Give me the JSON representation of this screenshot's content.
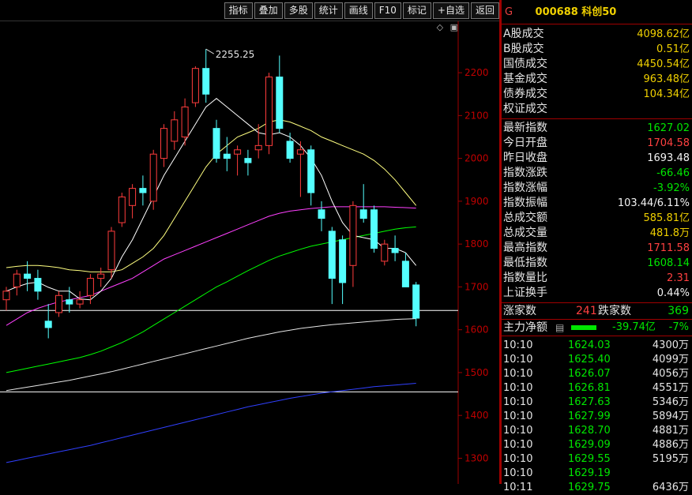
{
  "toolbar": {
    "buttons": [
      "指标",
      "叠加",
      "多股",
      "统计",
      "画线",
      "F10",
      "标记",
      "+自选",
      "返回"
    ]
  },
  "header": {
    "market_tag": "G",
    "code": "000688",
    "name": "科创50"
  },
  "chart_data": {
    "type": "candlestick",
    "yaxis": {
      "ticks": [
        "2200",
        "2100",
        "2000",
        "1900",
        "1800",
        "1700",
        "1600",
        "1500",
        "1400",
        "1300"
      ],
      "ylim": [
        1240,
        2320
      ]
    },
    "annotation": "2255.25",
    "horizontal_lines": [
      1645,
      1455
    ],
    "colors": {
      "up": "#ff3c3c",
      "down": "#54ffff",
      "ma5": "#ffffff",
      "ma10": "#ffff80",
      "ma20": "#ff40ff",
      "ma60": "#00ff00",
      "ma120": "#e6e6e6",
      "ma250": "#3040ff"
    },
    "candles": [
      {
        "o": 1670,
        "h": 1700,
        "l": 1645,
        "c": 1690
      },
      {
        "o": 1700,
        "h": 1740,
        "l": 1680,
        "c": 1730
      },
      {
        "o": 1730,
        "h": 1760,
        "l": 1690,
        "c": 1720
      },
      {
        "o": 1720,
        "h": 1740,
        "l": 1670,
        "c": 1690
      },
      {
        "o": 1620,
        "h": 1660,
        "l": 1580,
        "c": 1605
      },
      {
        "o": 1640,
        "h": 1690,
        "l": 1630,
        "c": 1680
      },
      {
        "o": 1670,
        "h": 1700,
        "l": 1640,
        "c": 1660
      },
      {
        "o": 1660,
        "h": 1690,
        "l": 1650,
        "c": 1670
      },
      {
        "o": 1680,
        "h": 1730,
        "l": 1660,
        "c": 1720
      },
      {
        "o": 1720,
        "h": 1745,
        "l": 1700,
        "c": 1730
      },
      {
        "o": 1740,
        "h": 1840,
        "l": 1720,
        "c": 1830
      },
      {
        "o": 1850,
        "h": 1920,
        "l": 1840,
        "c": 1910
      },
      {
        "o": 1890,
        "h": 1940,
        "l": 1860,
        "c": 1930
      },
      {
        "o": 1930,
        "h": 1960,
        "l": 1890,
        "c": 1920
      },
      {
        "o": 1900,
        "h": 2020,
        "l": 1880,
        "c": 2010
      },
      {
        "o": 2000,
        "h": 2080,
        "l": 1980,
        "c": 2070
      },
      {
        "o": 2040,
        "h": 2110,
        "l": 2020,
        "c": 2090
      },
      {
        "o": 2050,
        "h": 2140,
        "l": 2030,
        "c": 2120
      },
      {
        "o": 2130,
        "h": 2215,
        "l": 2120,
        "c": 2210
      },
      {
        "o": 2210,
        "h": 2255.25,
        "l": 2130,
        "c": 2150
      },
      {
        "o": 2070,
        "h": 2090,
        "l": 1990,
        "c": 2000
      },
      {
        "o": 2010,
        "h": 2050,
        "l": 1970,
        "c": 2000
      },
      {
        "o": 2010,
        "h": 2030,
        "l": 1960,
        "c": 2020
      },
      {
        "o": 2000,
        "h": 2020,
        "l": 1960,
        "c": 1990
      },
      {
        "o": 2020,
        "h": 2080,
        "l": 2000,
        "c": 2030
      },
      {
        "o": 2030,
        "h": 2200,
        "l": 2010,
        "c": 2190
      },
      {
        "o": 2190,
        "h": 2240,
        "l": 2060,
        "c": 2070
      },
      {
        "o": 2040,
        "h": 2060,
        "l": 1990,
        "c": 2000
      },
      {
        "o": 2010,
        "h": 2040,
        "l": 1910,
        "c": 2020
      },
      {
        "o": 2020,
        "h": 2030,
        "l": 1890,
        "c": 1920
      },
      {
        "o": 1880,
        "h": 1900,
        "l": 1830,
        "c": 1860
      },
      {
        "o": 1830,
        "h": 1840,
        "l": 1660,
        "c": 1720
      },
      {
        "o": 1810,
        "h": 1820,
        "l": 1660,
        "c": 1710
      },
      {
        "o": 1750,
        "h": 1900,
        "l": 1700,
        "c": 1890
      },
      {
        "o": 1880,
        "h": 1940,
        "l": 1850,
        "c": 1860
      },
      {
        "o": 1880,
        "h": 1890,
        "l": 1780,
        "c": 1790
      },
      {
        "o": 1760,
        "h": 1810,
        "l": 1750,
        "c": 1800
      },
      {
        "o": 1790,
        "h": 1820,
        "l": 1760,
        "c": 1780
      },
      {
        "o": 1760,
        "h": 1780,
        "l": 1700,
        "c": 1700
      },
      {
        "o": 1704.58,
        "h": 1711.58,
        "l": 1608.14,
        "c": 1627.02
      }
    ],
    "ma5": [
      1690,
      1700,
      1708,
      1711,
      1699,
      1690,
      1690,
      1672,
      1670,
      1690,
      1720,
      1770,
      1810,
      1860,
      1910,
      1960,
      2000,
      2040,
      2080,
      2120,
      2140,
      2120,
      2100,
      2080,
      2060,
      2055,
      2060,
      2050,
      2030,
      2000,
      1960,
      1900,
      1850,
      1820,
      1815,
      1810,
      1790,
      1790,
      1780,
      1750
    ],
    "ma10": [
      1745,
      1748,
      1750,
      1750,
      1748,
      1745,
      1740,
      1738,
      1735,
      1735,
      1735,
      1740,
      1755,
      1770,
      1790,
      1820,
      1860,
      1900,
      1940,
      1980,
      2010,
      2030,
      2050,
      2060,
      2070,
      2085,
      2090,
      2085,
      2075,
      2065,
      2050,
      2040,
      2030,
      2020,
      2010,
      1995,
      1975,
      1950,
      1920,
      1890
    ],
    "ma20": [
      1610,
      1625,
      1640,
      1650,
      1658,
      1665,
      1670,
      1675,
      1680,
      1690,
      1700,
      1710,
      1720,
      1735,
      1750,
      1765,
      1775,
      1785,
      1795,
      1805,
      1815,
      1825,
      1835,
      1845,
      1855,
      1865,
      1872,
      1877,
      1880,
      1883,
      1885,
      1887,
      1887,
      1887,
      1887,
      1887,
      1887,
      1886,
      1885,
      1884
    ],
    "ma60": [
      1500,
      1505,
      1510,
      1515,
      1520,
      1525,
      1530,
      1535,
      1542,
      1550,
      1560,
      1570,
      1582,
      1595,
      1610,
      1625,
      1640,
      1655,
      1670,
      1685,
      1700,
      1712,
      1725,
      1738,
      1750,
      1762,
      1772,
      1780,
      1788,
      1795,
      1800,
      1805,
      1810,
      1815,
      1820,
      1825,
      1830,
      1835,
      1838,
      1840
    ],
    "ma120": [
      1458,
      1462,
      1466,
      1470,
      1474,
      1478,
      1482,
      1487,
      1492,
      1497,
      1502,
      1508,
      1514,
      1520,
      1526,
      1532,
      1538,
      1544,
      1550,
      1556,
      1562,
      1568,
      1574,
      1580,
      1585,
      1590,
      1595,
      1599,
      1603,
      1606,
      1609,
      1612,
      1614,
      1616,
      1618,
      1620,
      1622,
      1624,
      1625,
      1626
    ],
    "ma250": [
      1290,
      1295,
      1300,
      1305,
      1310,
      1315,
      1320,
      1325,
      1330,
      1336,
      1342,
      1348,
      1354,
      1360,
      1366,
      1372,
      1378,
      1384,
      1390,
      1396,
      1402,
      1408,
      1414,
      1420,
      1425,
      1430,
      1435,
      1440,
      1444,
      1448,
      1452,
      1455,
      1458,
      1461,
      1464,
      1467,
      1469,
      1471,
      1473,
      1475
    ]
  },
  "turnover": [
    {
      "label": "A股成交",
      "value": "4098.62",
      "unit": "亿",
      "color": "#f0d000"
    },
    {
      "label": "B股成交",
      "value": "0.51",
      "unit": "亿",
      "color": "#f0d000"
    },
    {
      "label": "国债成交",
      "value": "4450.54",
      "unit": "亿",
      "color": "#f0d000"
    },
    {
      "label": "基金成交",
      "value": "963.48",
      "unit": "亿",
      "color": "#f0d000"
    },
    {
      "label": "债券成交",
      "value": "104.34",
      "unit": "亿",
      "color": "#f0d000"
    },
    {
      "label": "权证成交",
      "value": "",
      "unit": "",
      "color": "#f0d000"
    }
  ],
  "quote": [
    {
      "label": "最新指数",
      "value": "1627.02",
      "color": "#00e600"
    },
    {
      "label": "今日开盘",
      "value": "1704.58",
      "color": "#ff4040"
    },
    {
      "label": "昨日收盘",
      "value": "1693.48",
      "color": "#f2f2f2"
    },
    {
      "label": "指数涨跌",
      "value": "-66.46",
      "color": "#00e600"
    },
    {
      "label": "指数涨幅",
      "value": "-3.92%",
      "color": "#00e600"
    },
    {
      "label": "指数振幅",
      "value": "103.44/6.11%",
      "color": "#f2f2f2"
    },
    {
      "label": "总成交额",
      "value": "585.81亿",
      "color": "#f0d000"
    },
    {
      "label": "总成交量",
      "value": "481.8万",
      "color": "#f0d000"
    },
    {
      "label": "最高指数",
      "value": "1711.58",
      "color": "#ff4040"
    },
    {
      "label": "最低指数",
      "value": "1608.14",
      "color": "#00e600"
    },
    {
      "label": "指数量比",
      "value": "2.31",
      "color": "#ff4040"
    },
    {
      "label": "上证换手",
      "value": "0.44%",
      "color": "#f2f2f2"
    }
  ],
  "breadth": {
    "up_label": "涨家数",
    "up_value": "241",
    "down_label": "跌家数",
    "down_value": "369"
  },
  "capital": {
    "label": "主力净额",
    "value": "-39.74亿",
    "pct": "-7%"
  },
  "ticks": [
    {
      "time": "10:10",
      "price": "1624.03",
      "vol": "4300万"
    },
    {
      "time": "10:10",
      "price": "1625.40",
      "vol": "4099万"
    },
    {
      "time": "10:10",
      "price": "1626.07",
      "vol": "4056万"
    },
    {
      "time": "10:10",
      "price": "1626.81",
      "vol": "4551万"
    },
    {
      "time": "10:10",
      "price": "1627.63",
      "vol": "5346万"
    },
    {
      "time": "10:10",
      "price": "1627.99",
      "vol": "5894万"
    },
    {
      "time": "10:10",
      "price": "1628.70",
      "vol": "4881万"
    },
    {
      "time": "10:10",
      "price": "1629.09",
      "vol": "4886万"
    },
    {
      "time": "10:10",
      "price": "1629.55",
      "vol": "5195万"
    },
    {
      "time": "10:10",
      "price": "1629.19",
      "vol": ""
    },
    {
      "time": "10:11",
      "price": "1629.75",
      "vol": "6436万"
    }
  ]
}
